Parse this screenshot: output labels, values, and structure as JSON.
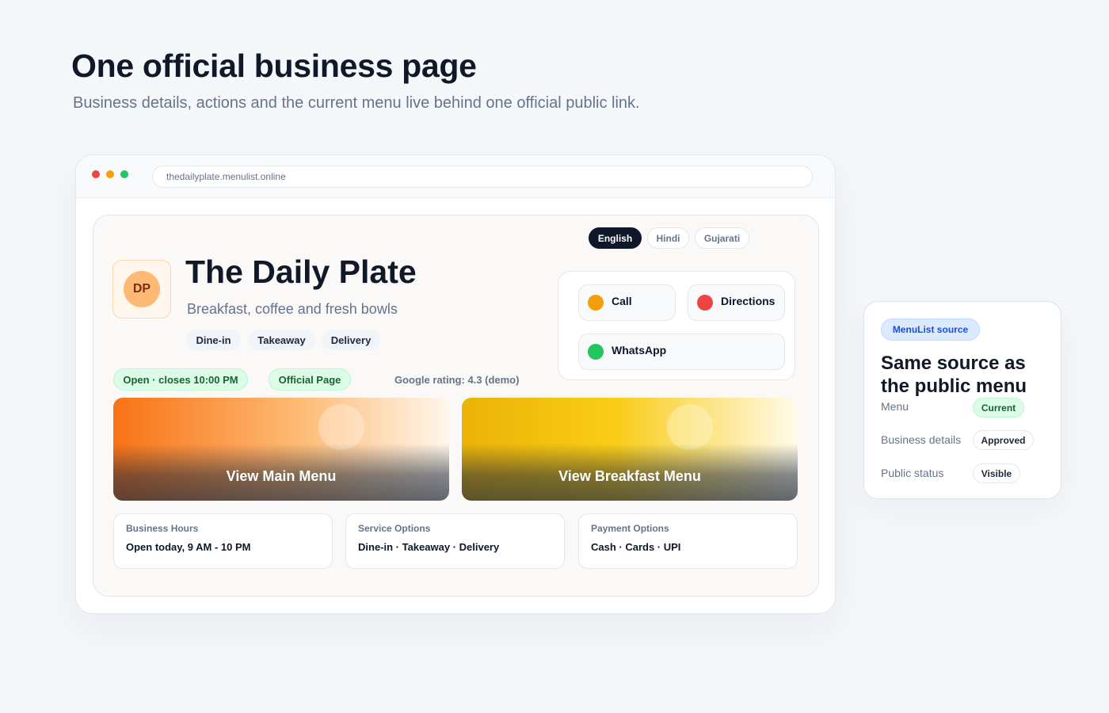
{
  "header": {
    "title": "One official business page",
    "subtitle": "Business details, actions and the current menu live behind one official public link."
  },
  "browser": {
    "url": "thedailyplate.menulist.online"
  },
  "business": {
    "logo_initials": "DP",
    "name": "The Daily Plate",
    "tagline": "Breakfast, coffee and fresh bowls",
    "languages": [
      "English",
      "Hindi",
      "Gujarati"
    ],
    "active_language": "English",
    "service_chips": [
      "Dine-in",
      "Takeaway",
      "Delivery"
    ],
    "status_open": "Open · closes 10:00 PM",
    "status_official": "Official Page",
    "rating": "Google rating: 4.3 (demo)"
  },
  "actions": {
    "call": "Call",
    "directions": "Directions",
    "whatsapp": "WhatsApp",
    "colors": {
      "call": "#f59e0b",
      "directions": "#ef4444",
      "whatsapp": "#22c55e"
    }
  },
  "menus": [
    {
      "label": "View Main Menu"
    },
    {
      "label": "View Breakfast Menu"
    }
  ],
  "info_cards": [
    {
      "title": "Business Hours",
      "value": "Open today, 9 AM - 10 PM"
    },
    {
      "title": "Service Options",
      "value": "Dine-in · Takeaway · Delivery"
    },
    {
      "title": "Payment Options",
      "value": "Cash · Cards · UPI"
    }
  ],
  "source_panel": {
    "badge": "MenuList source",
    "title": "Same source as the public menu",
    "rows": [
      {
        "label": "Menu",
        "status": "Current"
      },
      {
        "label": "Business details",
        "status": "Approved"
      },
      {
        "label": "Public status",
        "status": "Visible"
      }
    ]
  }
}
